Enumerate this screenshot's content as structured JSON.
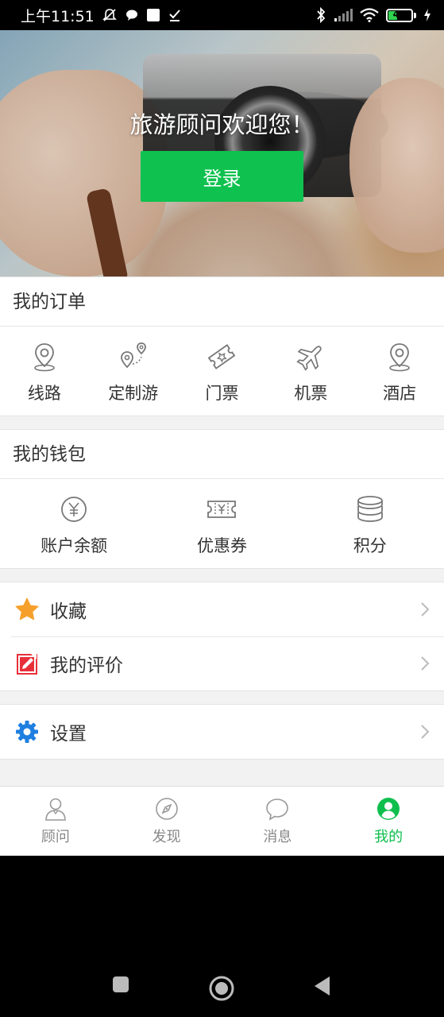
{
  "status_bar": {
    "time": "上午11:51",
    "battery_level": "41",
    "battery_percent": 41,
    "icons_left": [
      "mute-bell-icon",
      "chat-bubble-icon",
      "square-icon",
      "check-download-icon"
    ],
    "icons_right": [
      "bluetooth-icon",
      "signal-icon",
      "wifi-icon",
      "battery-icon",
      "charging-icon"
    ]
  },
  "hero": {
    "welcome": "旅游顾问欢迎您！",
    "login_label": "登录"
  },
  "orders": {
    "title": "我的订单",
    "items": [
      {
        "label": "线路",
        "icon": "location-pin-icon"
      },
      {
        "label": "定制游",
        "icon": "custom-route-icon"
      },
      {
        "label": "门票",
        "icon": "ticket-icon"
      },
      {
        "label": "机票",
        "icon": "plane-icon"
      },
      {
        "label": "酒店",
        "icon": "hotel-pin-icon"
      }
    ]
  },
  "wallet": {
    "title": "我的钱包",
    "items": [
      {
        "label": "账户余额",
        "icon": "yuan-coin-icon"
      },
      {
        "label": "优惠券",
        "icon": "coupon-icon"
      },
      {
        "label": "积分",
        "icon": "coin-stack-icon"
      }
    ]
  },
  "menu": {
    "favorites": "收藏",
    "reviews": "我的评价",
    "settings": "设置"
  },
  "tabs": [
    {
      "label": "顾问",
      "icon": "person-icon",
      "active": false
    },
    {
      "label": "发现",
      "icon": "compass-icon",
      "active": false
    },
    {
      "label": "消息",
      "icon": "message-icon",
      "active": false
    },
    {
      "label": "我的",
      "icon": "profile-icon",
      "active": true
    }
  ],
  "colors": {
    "accent_green": "#0fc14f",
    "star_orange": "#f5a02a",
    "review_red": "#e8303a",
    "settings_blue": "#1e7fe0"
  }
}
